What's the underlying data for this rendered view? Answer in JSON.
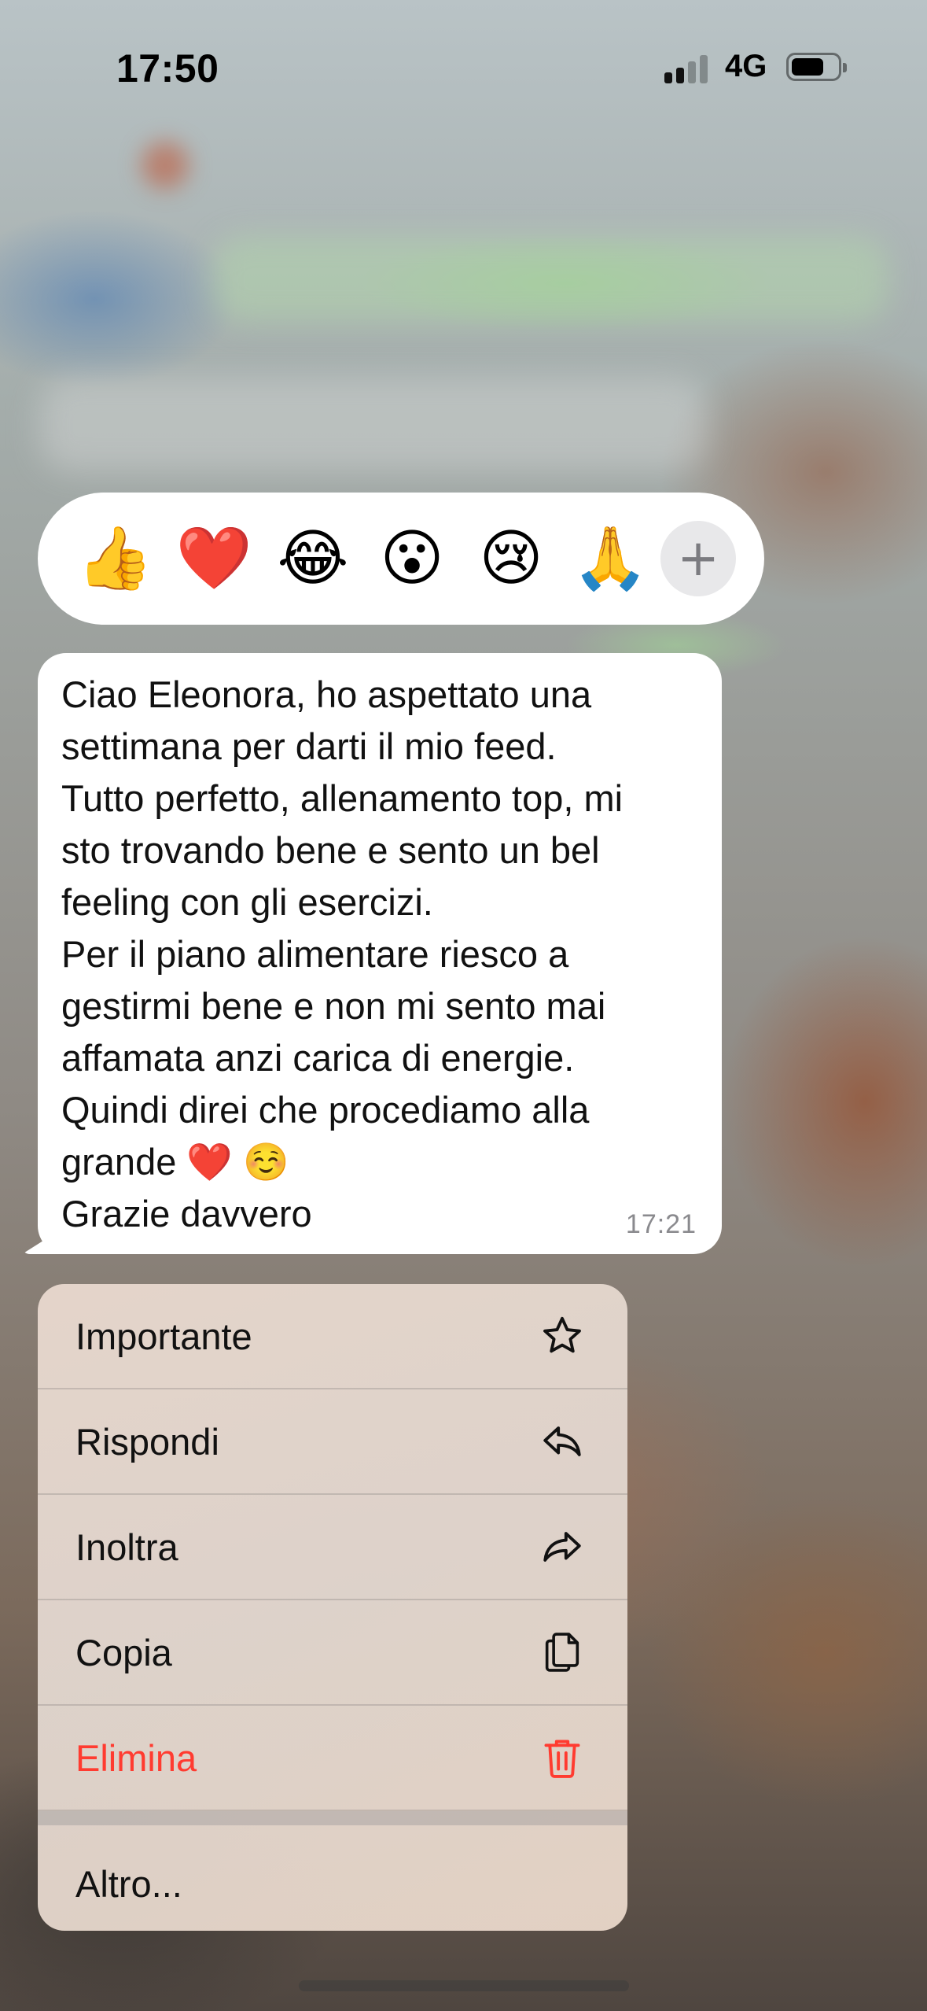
{
  "status_bar": {
    "time": "17:50",
    "network": "4G",
    "battery_level": 0.65
  },
  "reactions": {
    "emojis": [
      "👍",
      "❤️",
      "😂",
      "😮",
      "😢",
      "🙏"
    ],
    "more_label": "+"
  },
  "message": {
    "text": "Ciao Eleonora, ho aspettato una\nsettimana per darti il mio feed.\nTutto perfetto, allenamento top, mi\nsto trovando bene e sento un bel\nfeeling con gli esercizi.\nPer il piano alimentare riesco a\ngestirmi bene e non mi sento mai\naffamata anzi carica di energie.\nQuindi direi che procediamo alla\ngrande ❤️ ☺️\nGrazie davvero",
    "time": "17:21"
  },
  "menu": {
    "items": [
      {
        "label": "Importante",
        "icon": "star-icon"
      },
      {
        "label": "Rispondi",
        "icon": "reply-icon"
      },
      {
        "label": "Inoltra",
        "icon": "forward-icon"
      },
      {
        "label": "Copia",
        "icon": "copy-icon"
      },
      {
        "label": "Elimina",
        "icon": "trash-icon",
        "color": "#ff3b30"
      }
    ],
    "more_label": "Altro..."
  }
}
